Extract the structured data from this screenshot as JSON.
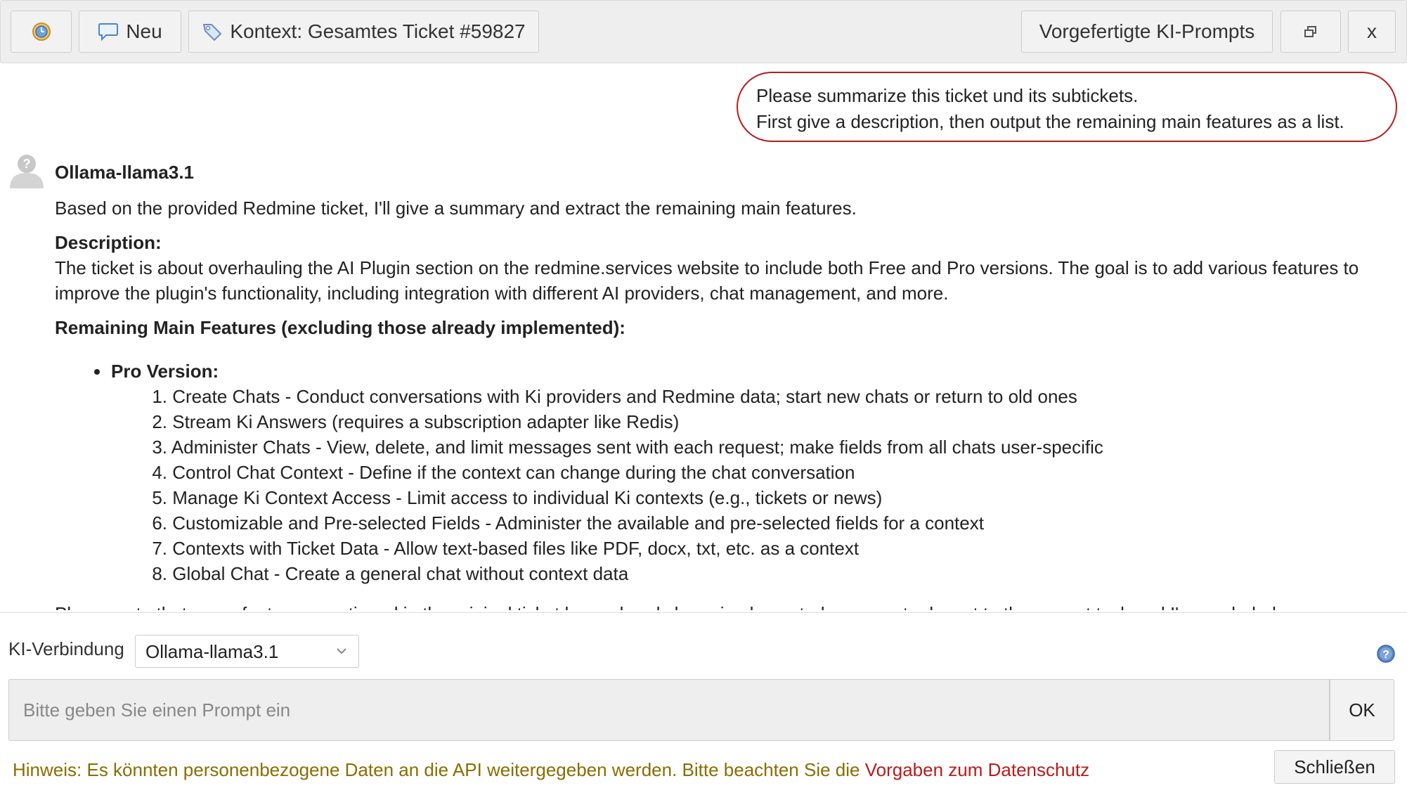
{
  "toolbar": {
    "history_icon": "clock-icon",
    "new_label": "Neu",
    "new_icon": "speech-bubble-icon",
    "context_label": "Kontext: Gesamtes Ticket #59827",
    "context_icon": "tag-icon",
    "prompts_label": "Vorgefertigte KI-Prompts",
    "window_icon": "restore-window-icon",
    "close_label": "x"
  },
  "chat": {
    "user_message": {
      "line1": "Please summarize this ticket und its subtickets.",
      "line2": "First give a description, then output the remaining main features as a list."
    },
    "bot": {
      "name": "Ollama-llama3.1",
      "intro": "Based on the provided Redmine ticket, I'll give a summary and extract the remaining main features.",
      "description_heading": "Description:",
      "description": "The ticket is about overhauling the AI Plugin section on the redmine.services website to include both Free and Pro versions. The goal is to add various features to improve the plugin's functionality, including integration with different AI providers, chat management, and more.",
      "features_heading": "Remaining Main Features (excluding those already implemented):",
      "bullet_heading": "Pro Version:",
      "features": [
        "Create Chats - Conduct conversations with Ki providers and Redmine data; start new chats or return to old ones",
        "Stream Ki Answers (requires a subscription adapter like Redis)",
        "Administer Chats - View, delete, and limit messages sent with each request; make fields from all chats user-specific",
        "Control Chat Context - Define if the context can change during the chat conversation",
        "Manage Ki Context Access - Limit access to individual Ki contexts (e.g., tickets or news)",
        "Customizable and Pre-selected Fields - Administer the available and pre-selected fields for a context",
        "Contexts with Ticket Data - Allow text-based files like PDF, docx, txt, etc. as a context",
        "Global Chat - Create a general chat without context data"
      ],
      "cut_off_line": "Please note that some features mentioned in the original ticket have already been implemented or are not relevant to the current task and I've excluded"
    }
  },
  "form": {
    "connection_label": "KI-Verbindung",
    "connection_value": "Ollama-llama3.1",
    "prompt_placeholder": "Bitte geben Sie einen Prompt ein",
    "ok_label": "OK",
    "notice_text": "Hinweis: Es könnten personenbezogene Daten an die API weitergegeben werden. Bitte beachten Sie die ",
    "notice_link": "Vorgaben zum Datenschutz",
    "close_label": "Schließen"
  },
  "colors": {
    "accent_red": "#b71c1c",
    "notice": "#8a6d00",
    "toolbar_bg": "#eeeeee",
    "input_bg": "#eeeeee"
  }
}
